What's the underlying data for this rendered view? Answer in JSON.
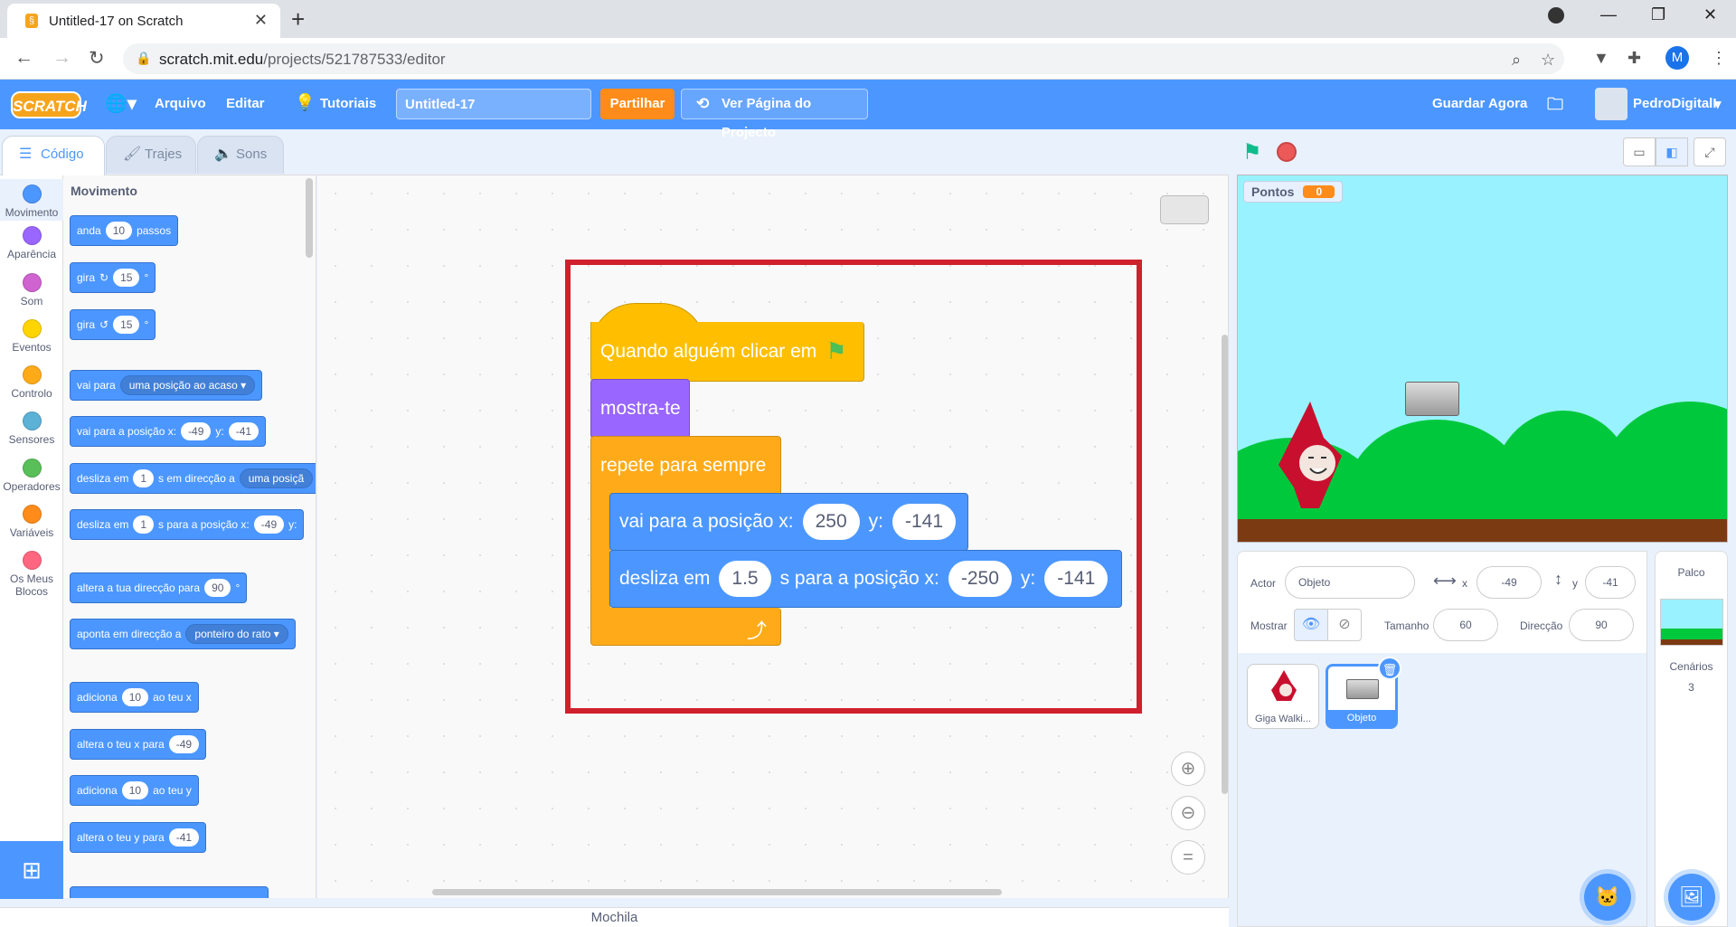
{
  "browser": {
    "tab_title": "Untitled-17 on Scratch",
    "url_host": "scratch.mit.edu",
    "url_path": "/projects/521787533/editor",
    "profile_initial": "M"
  },
  "menu": {
    "logo": "SCRATCH",
    "file": "Arquivo",
    "edit": "Editar",
    "tutorials": "Tutoriais",
    "project_title": "Untitled-17",
    "share": "Partilhar",
    "see_project": "Ver Página do Projecto",
    "save_now": "Guardar Agora",
    "username": "PedroDigitalI"
  },
  "editor_tabs": {
    "code": "Código",
    "costumes": "Trajes",
    "sounds": "Sons"
  },
  "categories": [
    {
      "label": "Movimento",
      "color": "#4c97ff"
    },
    {
      "label": "Aparência",
      "color": "#9966ff"
    },
    {
      "label": "Som",
      "color": "#cf63cf"
    },
    {
      "label": "Eventos",
      "color": "#ffd500"
    },
    {
      "label": "Controlo",
      "color": "#ffab19"
    },
    {
      "label": "Sensores",
      "color": "#5cb1d6"
    },
    {
      "label": "Operadores",
      "color": "#59c059"
    },
    {
      "label": "Variáveis",
      "color": "#ff8c1a"
    },
    {
      "label": "Os Meus Blocos",
      "color": "#ff6680"
    }
  ],
  "palette": {
    "heading": "Movimento",
    "move": {
      "a": "anda",
      "n": "10",
      "b": "passos"
    },
    "turn_right": {
      "a": "gira",
      "n": "15",
      "b": "°"
    },
    "turn_left": {
      "a": "gira",
      "n": "15",
      "b": "°"
    },
    "goto_random": {
      "a": "vai para",
      "drop": "uma posição ao acaso"
    },
    "goto_xy": {
      "a": "vai para a posição x:",
      "x": "-49",
      "b": "y:",
      "y": "-41"
    },
    "glide_random": {
      "a": "desliza em",
      "n": "1",
      "b": "s em direcção a",
      "drop": "uma posiçã"
    },
    "glide_xy": {
      "a": "desliza em",
      "n": "1",
      "b": "s para a posição x:",
      "x": "-49",
      "c": "y:"
    },
    "point_dir": {
      "a": "altera a tua direcção para",
      "n": "90",
      "b": "°"
    },
    "point_towards": {
      "a": "aponta em direcção a",
      "drop": "ponteiro do rato"
    },
    "change_x": {
      "a": "adiciona",
      "n": "10",
      "b": "ao teu x"
    },
    "set_x": {
      "a": "altera o teu x para",
      "n": "-49"
    },
    "change_y": {
      "a": "adiciona",
      "n": "10",
      "b": "ao teu y"
    },
    "set_y": {
      "a": "altera o teu y para",
      "n": "-41"
    }
  },
  "script": {
    "hat": "Quando alguém clicar em",
    "show": "mostra-te",
    "forever": "repete para sempre",
    "goto": {
      "a": "vai para a posição x:",
      "x": "250",
      "b": "y:",
      "y": "-141"
    },
    "glide": {
      "a": "desliza em",
      "t": "1.5",
      "b": "s para a posição x:",
      "x": "-250",
      "c": "y:",
      "y": "-141"
    }
  },
  "backpack": "Mochila",
  "stage": {
    "variable_name": "Pontos",
    "variable_value": "0"
  },
  "sprite_info": {
    "sprite_label": "Actor",
    "sprite_name": "Objeto",
    "x_label": "x",
    "x": "-49",
    "y_label": "y",
    "y": "-41",
    "show_label": "Mostrar",
    "size_label": "Tamanho",
    "size": "60",
    "direction_label": "Direcção",
    "direction": "90"
  },
  "sprites": [
    {
      "name": "Giga Walki..."
    },
    {
      "name": "Objeto"
    }
  ],
  "stage_panel": {
    "title": "Palco",
    "backdrops_label": "Cenários",
    "backdrops_count": "3"
  },
  "colors": {
    "accent": "#4c97ff",
    "highlight": "#d0202e"
  }
}
